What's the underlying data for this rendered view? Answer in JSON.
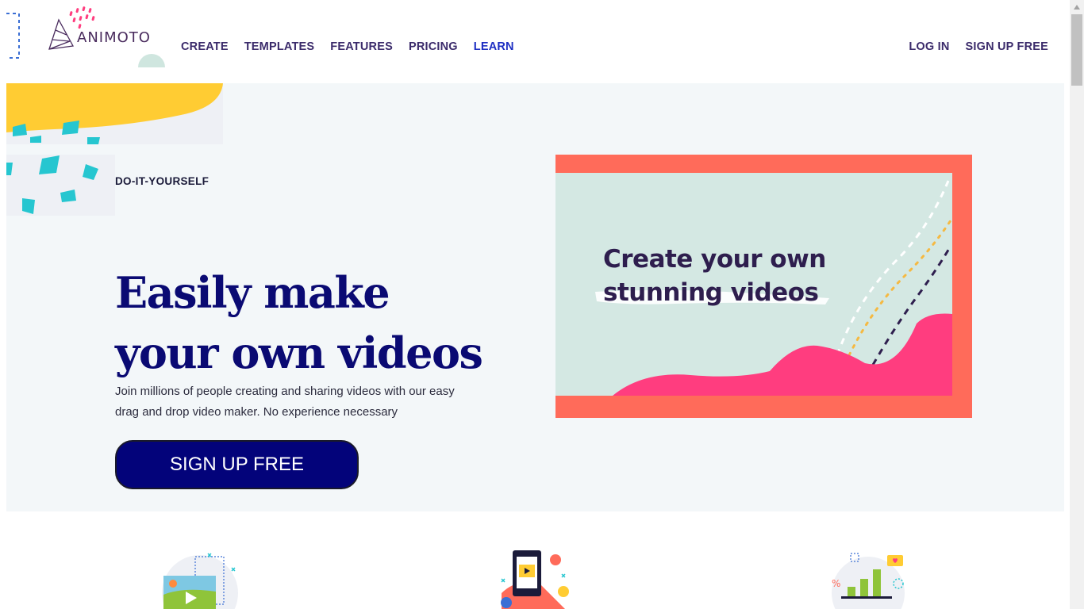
{
  "brand": {
    "name": "ANIMOTO"
  },
  "nav": {
    "items": [
      {
        "label": "CREATE"
      },
      {
        "label": "TEMPLATES"
      },
      {
        "label": "FEATURES"
      },
      {
        "label": "PRICING"
      },
      {
        "label": "LEARN"
      }
    ],
    "active_index": 4
  },
  "auth": {
    "login": "LOG IN",
    "signup": "SIGN UP FREE"
  },
  "hero": {
    "eyebrow": "DO-IT-YOURSELF",
    "headline": "Easily make your own videos",
    "subtext": "Join millions of people creating and sharing videos with our easy drag and drop video maker. No experience necessary",
    "cta": "SIGN UP FREE",
    "video_text_line1": "Create your own",
    "video_text_line2": "stunning videos"
  },
  "colors": {
    "primary_navy": "#03037a",
    "headline": "#0a0a73",
    "coral": "#ff6b5a",
    "pink": "#ff3d7f",
    "yellow": "#ffcc33",
    "teal": "#26c6d0",
    "mint": "#d4e8e3"
  },
  "icons": [
    "photo-edit-icon",
    "phone-social-icon",
    "bar-chart-icon"
  ]
}
